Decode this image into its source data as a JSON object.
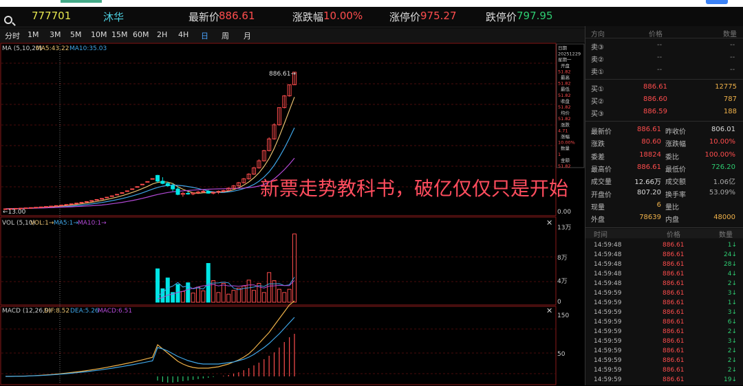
{
  "header": {
    "code": "777701",
    "name": "沐华",
    "last_label": "最新价",
    "last_value": "886.61",
    "change_label": "涨跌幅",
    "change_value": "10.00%",
    "limit_up_label": "涨停价",
    "limit_up_value": "975.27",
    "limit_down_label": "跌停价",
    "limit_down_value": "797.95"
  },
  "toolbar": {
    "items": [
      "分时",
      "1M",
      "3M",
      "5M",
      "10M",
      "15M",
      "60M",
      "2H",
      "4H",
      "日",
      "周",
      "月"
    ],
    "active": "日"
  },
  "main_chart": {
    "legend": {
      "title": "MA (5,10,20)",
      "ma5": "MA5:43.22",
      "ma10": "MA10:35.03"
    },
    "high_label": "886.61→",
    "low_label": "←13.00",
    "axis_zero": "0.00",
    "side_tags": [
      "日期",
      "20251229",
      "星期一",
      "开盘",
      "51.82",
      "最高",
      "51.82",
      "最低",
      "51.82",
      "收盘",
      "51.82",
      "均价",
      "51.82",
      "涨跌",
      "4.71",
      "涨幅",
      "10.00%",
      "数量",
      "1",
      "金额",
      "51.82"
    ]
  },
  "vol_chart": {
    "legend": {
      "title": "VOL (5,10)",
      "vol": "VOL:1→",
      "ma5": "MA5:1→",
      "ma10": "MA10:1→"
    },
    "ticks": [
      "13万",
      "8万",
      "4万",
      "0"
    ]
  },
  "macd_chart": {
    "legend": {
      "title": "MACD (12,26,9)",
      "dif": "DIF:8.52",
      "dea": "DEA:5.26",
      "macd": "MACD:6.51"
    },
    "ticks": [
      "150",
      "50"
    ]
  },
  "overlay_text": "新票走势教科书，破亿仅仅只是开始",
  "colors": {
    "up": "#ff4d4d",
    "down": "#00e5e5",
    "ma5": "#e8c070",
    "ma10": "#3fa6e8",
    "ma20": "#b44ad8",
    "highlight": "#f0b24a",
    "green": "#2ecc71"
  },
  "chart_data": {
    "type": "candlestick",
    "ohlc": [
      [
        13.0,
        13.0,
        13.0,
        13.0
      ],
      [
        14.3,
        14.3,
        14.3,
        14.3
      ],
      [
        15.7,
        15.7,
        15.7,
        15.7
      ],
      [
        17.3,
        17.3,
        17.3,
        17.3
      ],
      [
        19.0,
        19.0,
        19.0,
        19.0
      ],
      [
        20.9,
        20.9,
        20.9,
        20.9
      ],
      [
        23.0,
        23.0,
        23.0,
        23.0
      ],
      [
        25.3,
        25.3,
        25.3,
        25.3
      ],
      [
        27.8,
        27.8,
        27.8,
        27.8
      ],
      [
        30.6,
        30.6,
        30.6,
        30.6
      ],
      [
        33.7,
        33.7,
        33.7,
        33.7
      ],
      [
        37.1,
        37.1,
        37.1,
        37.1
      ],
      [
        40.8,
        40.8,
        40.8,
        40.8
      ],
      [
        44.9,
        44.9,
        44.9,
        44.9
      ],
      [
        49.4,
        49.4,
        49.4,
        49.4
      ],
      [
        54.3,
        54.3,
        54.3,
        54.3
      ],
      [
        59.7,
        59.7,
        59.7,
        59.7
      ],
      [
        65.7,
        65.7,
        65.7,
        65.7
      ],
      [
        72.3,
        72.3,
        72.3,
        72.3
      ],
      [
        79.5,
        79.5,
        79.5,
        79.5
      ],
      [
        87.5,
        87.5,
        87.5,
        87.5
      ],
      [
        96.2,
        96.2,
        96.2,
        96.2
      ],
      [
        105.8,
        105.8,
        105.8,
        105.8
      ],
      [
        116.4,
        116.4,
        116.4,
        116.4
      ],
      [
        128.0,
        128.0,
        128.0,
        128.0
      ],
      [
        140.8,
        140.8,
        140.8,
        140.8
      ],
      [
        154.9,
        154.9,
        154.9,
        154.9
      ],
      [
        170.4,
        170.4,
        170.4,
        170.4
      ],
      [
        187.4,
        187.4,
        187.4,
        187.4
      ],
      [
        206.1,
        206.1,
        206.1,
        206.1
      ],
      [
        226.7,
        230.0,
        180.0,
        190.0
      ],
      [
        190.0,
        215.0,
        170.0,
        175.0
      ],
      [
        175.0,
        185.0,
        155.0,
        160.0
      ],
      [
        160.0,
        175.0,
        125.0,
        140.0
      ],
      [
        140.0,
        155.0,
        100.0,
        105.0
      ],
      [
        105.0,
        120.0,
        90.0,
        112.0
      ],
      [
        112.0,
        124.0,
        103.0,
        108.0
      ],
      [
        108.0,
        118.0,
        100.0,
        115.0
      ],
      [
        115.0,
        128.0,
        108.0,
        120.0
      ],
      [
        120.0,
        135.0,
        115.0,
        125.0
      ],
      [
        125.0,
        133.0,
        110.0,
        113.0
      ],
      [
        113.0,
        125.0,
        105.0,
        118.0
      ],
      [
        118.0,
        130.0,
        108.0,
        125.0
      ],
      [
        125.0,
        135.0,
        118.0,
        130.0
      ],
      [
        130.0,
        150.0,
        125.0,
        145.0
      ],
      [
        145.0,
        165.0,
        140.0,
        160.0
      ],
      [
        160.0,
        185.0,
        155.0,
        180.0
      ],
      [
        180.0,
        210.0,
        175.0,
        205.0
      ],
      [
        205.0,
        240.0,
        200.0,
        235.0
      ],
      [
        235.0,
        280.0,
        230.0,
        275.0
      ],
      [
        275.0,
        330.0,
        270.0,
        320.0
      ],
      [
        320.0,
        390.0,
        315.0,
        385.0
      ],
      [
        385.0,
        470.0,
        380.0,
        460.0
      ],
      [
        460.0,
        560.0,
        455.0,
        550.0
      ],
      [
        550.0,
        660.0,
        545.0,
        660.0
      ],
      [
        660.0,
        740.0,
        655.0,
        735.0
      ],
      [
        735.0,
        806.0,
        730.0,
        806.0
      ],
      [
        806.0,
        886.61,
        806.0,
        886.61
      ]
    ],
    "volume": [
      1,
      1,
      1,
      1,
      1,
      1,
      1,
      1,
      1,
      1,
      1,
      1,
      1,
      1,
      1,
      1,
      1,
      1,
      1,
      1,
      1,
      1,
      1,
      1,
      1,
      1,
      1,
      1,
      1,
      1,
      62000,
      25000,
      45000,
      18000,
      33000,
      20000,
      36000,
      17000,
      28000,
      21000,
      72000,
      40000,
      18000,
      35000,
      15000,
      22000,
      26000,
      30000,
      41000,
      22000,
      35000,
      18000,
      55000,
      40000,
      24000,
      18000,
      24000,
      126600
    ],
    "macd": [
      0,
      0,
      0,
      0,
      0,
      0,
      0,
      0,
      0,
      0,
      0,
      0,
      0,
      0,
      0,
      0,
      0,
      0,
      0,
      0,
      0,
      0,
      0,
      0,
      0,
      0,
      0,
      0,
      0,
      0,
      -6,
      -8,
      -9,
      -9,
      -8,
      -7,
      -6,
      -5,
      -4,
      -3,
      -2,
      -1,
      0,
      1,
      2,
      4,
      6,
      9,
      12,
      16,
      20,
      25,
      30,
      35,
      42,
      50,
      57,
      62
    ]
  },
  "quote_panel": {
    "headers": {
      "side": "方向",
      "price": "价格",
      "qty": "数量"
    },
    "asks": [
      {
        "label": "卖③",
        "price": "--",
        "qty": "--"
      },
      {
        "label": "卖②",
        "price": "--",
        "qty": "--"
      },
      {
        "label": "卖①",
        "price": "--",
        "qty": "--"
      }
    ],
    "bids": [
      {
        "label": "买①",
        "price": "886.61",
        "qty": "12775"
      },
      {
        "label": "买②",
        "price": "886.60",
        "qty": "787"
      },
      {
        "label": "买③",
        "price": "886.59",
        "qty": "188"
      }
    ],
    "stats": [
      {
        "l1": "最新价",
        "v1": "886.61",
        "l2": "昨收价",
        "v2": "806.01"
      },
      {
        "l1": "涨跌",
        "v1": "80.60",
        "l2": "涨跌幅",
        "v2": "10.00%"
      },
      {
        "l1": "委差",
        "v1": "18824",
        "l2": "委比",
        "v2": "100.00%"
      },
      {
        "l1": "最高价",
        "v1": "886.61",
        "l2": "最低价",
        "v2": "726.20"
      },
      {
        "l1": "成交量",
        "v1": "12.66万",
        "l2": "成交额",
        "v2": "1.06亿"
      },
      {
        "l1": "开盘价",
        "v1": "807.20",
        "l2": "换手率",
        "v2": "53.09%"
      },
      {
        "l1": "现量",
        "v1": "6",
        "l2": "量比",
        "v2": ""
      },
      {
        "l1": "外盘",
        "v1": "78639",
        "l2": "内盘",
        "v2": "48000"
      }
    ],
    "ticks_headers": {
      "time": "时间",
      "price": "价格",
      "qty": "数量"
    },
    "ticks": [
      {
        "t": "14:59:48",
        "p": "886.61",
        "q": "1↓"
      },
      {
        "t": "14:59:48",
        "p": "886.61",
        "q": "24↓"
      },
      {
        "t": "14:59:48",
        "p": "886.61",
        "q": "28↓"
      },
      {
        "t": "14:59:48",
        "p": "886.61",
        "q": "4↓"
      },
      {
        "t": "14:59:48",
        "p": "886.61",
        "q": "2↓"
      },
      {
        "t": "14:59:59",
        "p": "886.61",
        "q": "3↓"
      },
      {
        "t": "14:59:59",
        "p": "886.61",
        "q": "1↓"
      },
      {
        "t": "14:59:59",
        "p": "886.61",
        "q": "3↓"
      },
      {
        "t": "14:59:59",
        "p": "886.61",
        "q": "6↓"
      },
      {
        "t": "14:59:59",
        "p": "886.61",
        "q": "2↓"
      },
      {
        "t": "14:59:59",
        "p": "886.61",
        "q": "3↓"
      },
      {
        "t": "14:59:59",
        "p": "886.61",
        "q": "2↓"
      },
      {
        "t": "14:59:59",
        "p": "886.61",
        "q": "2↓"
      },
      {
        "t": "14:59:59",
        "p": "886.61",
        "q": "2↓"
      },
      {
        "t": "14:59:59",
        "p": "886.61",
        "q": "19↓"
      }
    ]
  }
}
